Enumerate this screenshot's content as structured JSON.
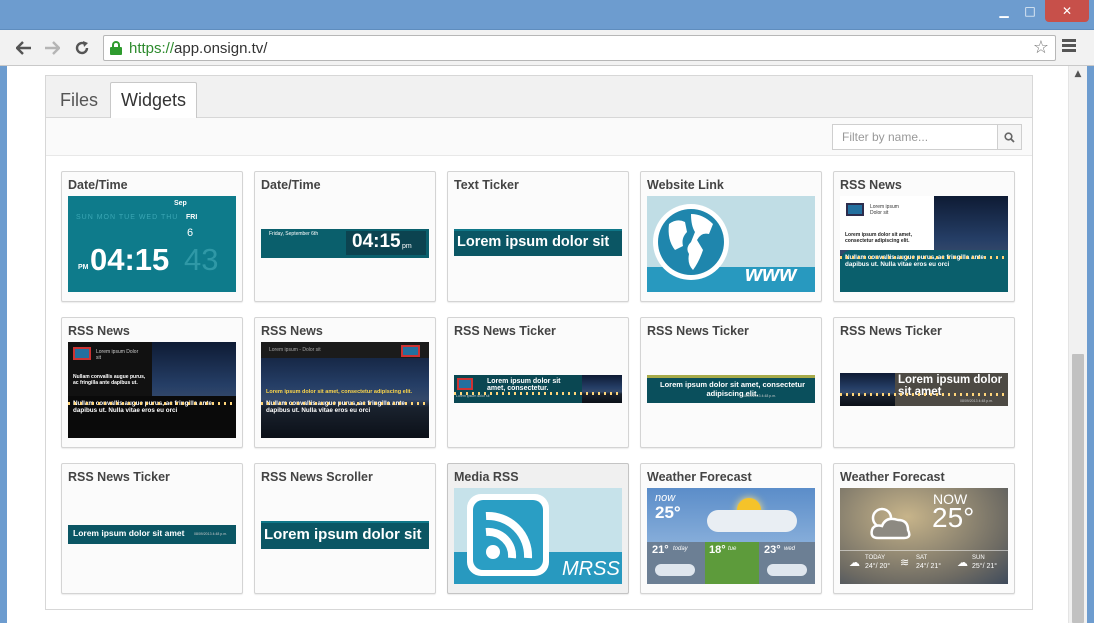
{
  "browser": {
    "url_protocol": "https://",
    "url_host": "app.onsign.tv/",
    "window_controls": {
      "minimize": "▁",
      "maximize": "□",
      "close": "✕"
    }
  },
  "tabs": [
    {
      "label": "Files",
      "selected": false
    },
    {
      "label": "Widgets",
      "selected": true
    }
  ],
  "filter": {
    "placeholder": "Filter by name..."
  },
  "icons": {
    "back": "back-arrow-icon",
    "forward": "forward-arrow-icon",
    "reload": "reload-icon",
    "lock": "lock-icon",
    "star": "star-icon",
    "menu": "menu-icon",
    "search": "search-icon"
  },
  "widgets": [
    {
      "title": "Date/Time",
      "thumb": {
        "month": "Sep",
        "days": "SUN  MON  TUE  WED  THU",
        "day": "FRI",
        "date": "6",
        "ampm": "PM",
        "time": "04:15",
        "seconds": "43"
      }
    },
    {
      "title": "Date/Time",
      "thumb": {
        "date": "Friday, September 6th",
        "time": "04:15",
        "ampm": "pm"
      }
    },
    {
      "title": "Text Ticker",
      "thumb": {
        "text": "Lorem ipsum dolor sit"
      }
    },
    {
      "title": "Website Link",
      "thumb": {
        "text": "www"
      }
    },
    {
      "title": "RSS News",
      "thumb": {
        "small": "Lorem ipsum Dolor sit",
        "headline": "Lorem ipsum dolor sit amet, consectetur adipiscing elit.",
        "body": "Nullam convallis augue purus, ac fringilla ante dapibus ut. Nulla vitae eros eu orci"
      }
    },
    {
      "title": "RSS News",
      "thumb": {
        "small": "Lorem ipsum Dolor sit",
        "headline": "Nullam convallis augue purus, ac fringilla ante dapibus ut. Nulla vitae eros eu orci",
        "body": "Nullam convallis augue purus, ac fringilla ante dapibus ut. Nulla vitae eros eu orci"
      }
    },
    {
      "title": "RSS News",
      "thumb": {
        "small": "Lorem ipsum - Dolor sit",
        "headline": "Lorem ipsum dolor sit amet, consectetur adipiscing elit.",
        "body": "Nullam convallis augue purus, ac fringilla ante dapibus ut. Nulla vitae eros eu orci"
      }
    },
    {
      "title": "RSS News Ticker",
      "thumb": {
        "text": "Lorem ipsum dolor sit amet, consectetur.",
        "small": "Lorem ipsum dolor sit"
      }
    },
    {
      "title": "RSS News Ticker",
      "thumb": {
        "text": "Lorem ipsum dolor sit amet, consectetur adipiscing elit.",
        "small": "08/09/2013 4:48 p.m."
      }
    },
    {
      "title": "RSS News Ticker",
      "thumb": {
        "text": "Lorem ipsum dolor sit amet",
        "small": "08/09/2013 4:48 p.m."
      }
    },
    {
      "title": "RSS News Ticker",
      "thumb": {
        "text": "Lorem ipsum dolor sit amet",
        "small": "08/09/2013 4:48 p.m."
      }
    },
    {
      "title": "RSS News Scroller",
      "thumb": {
        "text": "Lorem ipsum dolor sit"
      }
    },
    {
      "title": "Media RSS",
      "thumb": {
        "text": "MRSS"
      }
    },
    {
      "title": "Weather Forecast",
      "thumb": {
        "now": "now",
        "temp": "25°",
        "d1": "21°",
        "d1l": "today",
        "d2": "18°",
        "d2l": "tue",
        "d3": "23°",
        "d3l": "wed"
      }
    },
    {
      "title": "Weather Forecast",
      "thumb": {
        "now": "NOW",
        "temp": "25°",
        "d1l": "TODAY",
        "d1": "24°/ 20°",
        "d2l": "SAT",
        "d2": "24°/ 21°",
        "d3l": "SUN",
        "d3": "25°/ 21°"
      }
    }
  ],
  "colors": {
    "teal": "#0f7d8c",
    "dark_teal": "#0b5e6b",
    "accent": "#2aa7c7"
  }
}
